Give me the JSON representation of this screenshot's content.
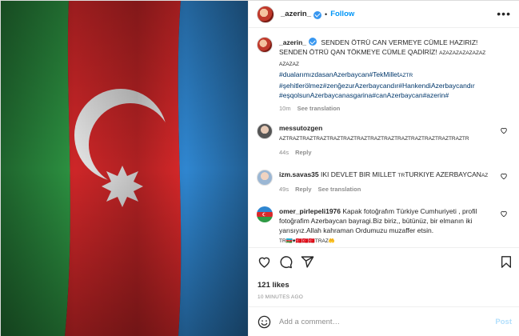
{
  "header": {
    "username": "_azerin_",
    "separator": "•",
    "follow_label": "Follow",
    "more_icon": "more-horizontal-icon"
  },
  "caption": {
    "username": "_azerin_",
    "text_main": "SENDEN ÖTRÜ CAN VERMEYE CÜMLE HAZIRIZ! SENDEN ÖTRÜ QAN TÖKMEYE CÜMLE QADİRİZ!",
    "text_small": "AZAZAZAZAZAZAZ AZAZAZ",
    "hashtags_1": "#dualarımızdasanAzerbaycan#TekMillet",
    "hashtags_1_small": "AZTR",
    "hashtags_2": "#şehitlerölmez#zenğezurAzerbaycandır#HankendiAzerbaycandır",
    "hashtags_3": "#eşqolsunAzerbaycanasgarina#canAzerbaycan#azerin#",
    "time": "10m",
    "see_translation": "See translation"
  },
  "comments": [
    {
      "username": "messutozgen",
      "text": "AZTRAZTRAZTRAZTRAZTRAZTRAZTRAZTRAZTRAZTRAZTRAZTRAZTRAZTR",
      "time": "44s",
      "reply": "Reply"
    },
    {
      "username": "izm.savas35",
      "text": "IKI DEVLET BIR MILLET",
      "text_small_1": "TR",
      "text_2": "TURKIYE AZERBAYCAN",
      "text_small_2": "AZ",
      "time": "49s",
      "reply": "Reply",
      "see_translation": "See translation"
    },
    {
      "username": "omer_pirlepeli1976",
      "text": "Kapak fotoğrafım Türkiye Cumhuriyeti , profil fotoğrafim Azerbaycan bayragi.Biz biriz,, bütünüz, bir elmanın iki yarısıyız.Allah kahraman Ordumuzu muzaffer etsin.",
      "tail": "TR🇦🇿♥🇹🇷🇹🇷🇹🇷TRAZ🤲"
    }
  ],
  "actions": {
    "like_icon": "heart-icon",
    "comment_icon": "comment-icon",
    "share_icon": "share-icon",
    "save_icon": "bookmark-icon"
  },
  "likes": "121 likes",
  "posted": "10 MINUTES AGO",
  "add_comment": {
    "emoji_icon": "emoji-icon",
    "placeholder": "Add a comment…",
    "post_label": "Post"
  },
  "colors": {
    "flag_blue": "#2f86d0",
    "flag_red": "#d8282a",
    "flag_green": "#2f9a45",
    "link": "#00376b",
    "accent": "#0095f6"
  }
}
